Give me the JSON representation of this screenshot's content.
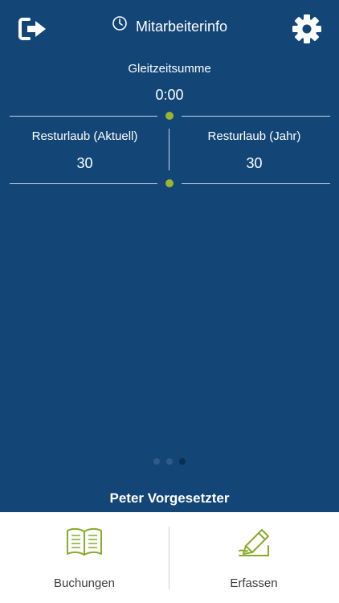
{
  "header": {
    "title": "Mitarbeiterinfo",
    "logout_icon": "logout-icon",
    "clock_icon": "clock-icon",
    "settings_icon": "gear-icon"
  },
  "summary": {
    "gleitzeit_label": "Gleitzeitsumme",
    "gleitzeit_value": "0:00",
    "urlaub_aktuell_label": "Resturlaub (Aktuell)",
    "urlaub_aktuell_value": "30",
    "urlaub_jahr_label": "Resturlaub (Jahr)",
    "urlaub_jahr_value": "30"
  },
  "pager": {
    "count": 3,
    "active_index": 2
  },
  "user": {
    "name": "Peter Vorgesetzter"
  },
  "tabs": [
    {
      "label": "Buchungen",
      "icon": "book-icon"
    },
    {
      "label": "Erfassen",
      "icon": "pen-writing-icon"
    }
  ],
  "colors": {
    "background": "#134677",
    "accent": "#9ab52e",
    "tab_text": "#3d3d3d"
  }
}
